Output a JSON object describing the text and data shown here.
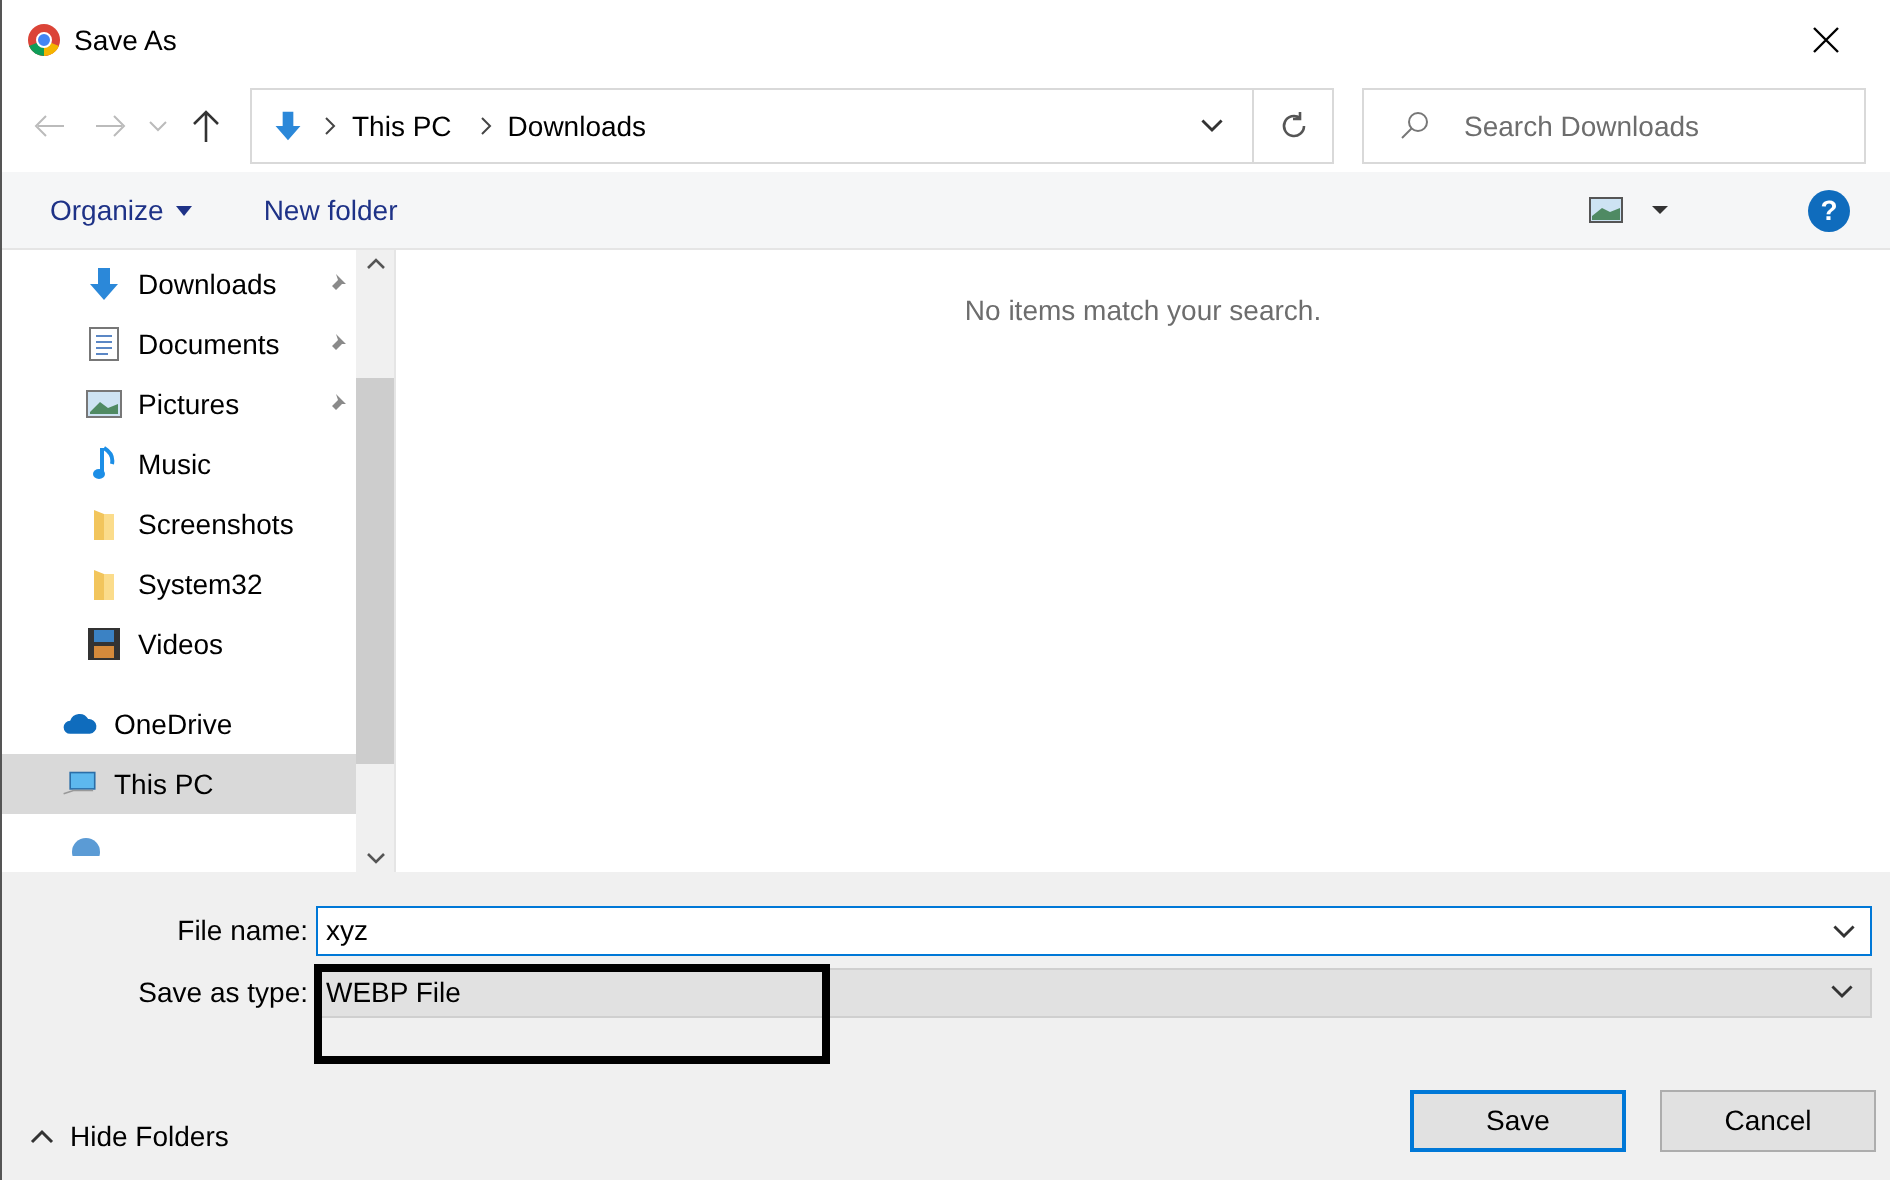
{
  "window": {
    "title": "Save As"
  },
  "address_bar": {
    "segments": [
      "This PC",
      "Downloads"
    ]
  },
  "search": {
    "placeholder": "Search Downloads"
  },
  "toolbar": {
    "organize": "Organize",
    "new_folder": "New folder",
    "help": "?"
  },
  "sidebar": {
    "items": [
      {
        "label": "Downloads",
        "kind": "downloads",
        "pinned": true,
        "selected": false
      },
      {
        "label": "Documents",
        "kind": "documents",
        "pinned": true,
        "selected": false
      },
      {
        "label": "Pictures",
        "kind": "pictures",
        "pinned": true,
        "selected": false
      },
      {
        "label": "Music",
        "kind": "music",
        "pinned": false,
        "selected": false
      },
      {
        "label": "Screenshots",
        "kind": "folder",
        "pinned": false,
        "selected": false
      },
      {
        "label": "System32",
        "kind": "folder",
        "pinned": false,
        "selected": false
      },
      {
        "label": "Videos",
        "kind": "videos",
        "pinned": false,
        "selected": false
      },
      {
        "label": "OneDrive",
        "kind": "cloud",
        "pinned": false,
        "selected": false
      },
      {
        "label": "This PC",
        "kind": "pc",
        "pinned": false,
        "selected": true
      }
    ]
  },
  "content": {
    "empty_message": "No items match your search."
  },
  "form": {
    "file_name_label": "File name:",
    "file_name": "xyz",
    "type_label": "Save as type:",
    "type_value": "WEBP File"
  },
  "hide_folders": "Hide Folders",
  "buttons": [
    {
      "label": "Save",
      "default": true
    },
    {
      "label": "Cancel",
      "default": false
    }
  ]
}
